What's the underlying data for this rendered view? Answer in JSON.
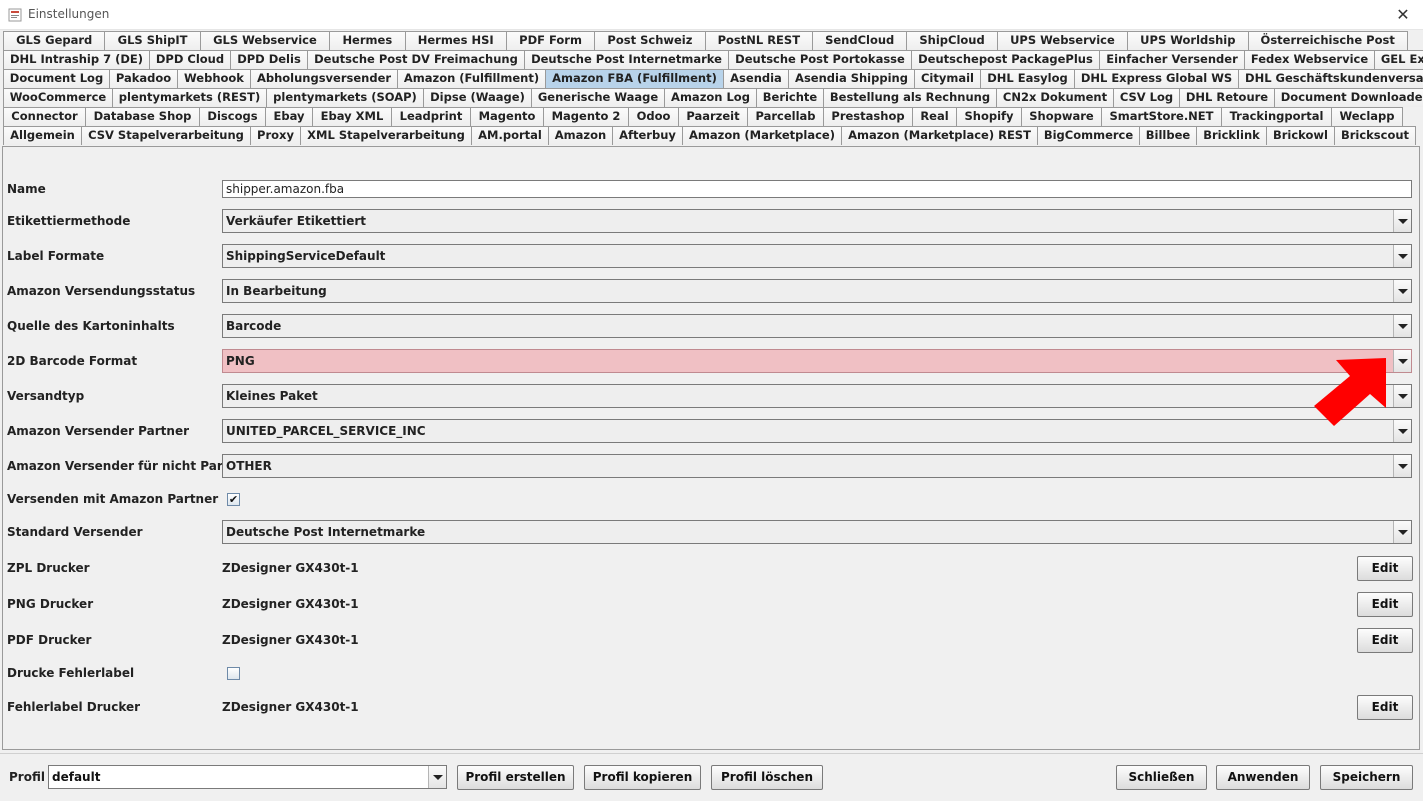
{
  "window": {
    "title": "Einstellungen",
    "close_glyph": "✕"
  },
  "tabs": {
    "rows": [
      [
        "GLS Gepard",
        "GLS ShipIT",
        "GLS Webservice",
        "Hermes",
        "Hermes HSI",
        "PDF Form",
        "Post Schweiz",
        "PostNL REST",
        "SendCloud",
        "ShipCloud",
        "UPS Webservice",
        "UPS Worldship",
        "Österreichische Post"
      ],
      [
        "DHL Intraship 7 (DE)",
        "DPD Cloud",
        "DPD Delis",
        "Deutsche Post DV Freimachung",
        "Deutsche Post Internetmarke",
        "Deutsche Post Portokasse",
        "Deutschepost PackagePlus",
        "Einfacher Versender",
        "Fedex Webservice",
        "GEL Express"
      ],
      [
        "Document Log",
        "Pakadoo",
        "Webhook",
        "Abholungsversender",
        "Amazon (Fulfillment)",
        "Amazon FBA (Fulfillment)",
        "Asendia",
        "Asendia Shipping",
        "Citymail",
        "DHL Easylog",
        "DHL Express Global WS",
        "DHL Geschäftskundenversand"
      ],
      [
        "WooCommerce",
        "plentymarkets (REST)",
        "plentymarkets (SOAP)",
        "Dipse (Waage)",
        "Generische Waage",
        "Amazon Log",
        "Berichte",
        "Bestellung als Rechnung",
        "CN2x Dokument",
        "CSV Log",
        "DHL Retoure",
        "Document Downloader"
      ],
      [
        "Connector",
        "Database Shop",
        "Discogs",
        "Ebay",
        "Ebay XML",
        "Leadprint",
        "Magento",
        "Magento 2",
        "Odoo",
        "Paarzeit",
        "Parcellab",
        "Prestashop",
        "Real",
        "Shopify",
        "Shopware",
        "SmartStore.NET",
        "Trackingportal",
        "Weclapp"
      ],
      [
        "Allgemein",
        "CSV Stapelverarbeitung",
        "Proxy",
        "XML Stapelverarbeitung",
        "AM.portal",
        "Amazon",
        "Afterbuy",
        "Amazon (Marketplace)",
        "Amazon (Marketplace) REST",
        "BigCommerce",
        "Billbee",
        "Bricklink",
        "Brickowl",
        "Brickscout"
      ]
    ],
    "active": "Amazon FBA (Fulfillment)"
  },
  "form": {
    "name": {
      "label": "Name",
      "value": "shipper.amazon.fba"
    },
    "etikettiermethode": {
      "label": "Etikettiermethode",
      "value": "Verkäufer Etikettiert"
    },
    "label_formate": {
      "label": "Label Formate",
      "value": "ShippingServiceDefault"
    },
    "versandungsstatus": {
      "label": "Amazon Versendungsstatus",
      "value": "In Bearbeitung"
    },
    "kartoninhalt": {
      "label": "Quelle des Kartoninhalts",
      "value": "Barcode"
    },
    "barcode_format": {
      "label": "2D Barcode Format",
      "value": "PNG"
    },
    "versandtyp": {
      "label": "Versandtyp",
      "value": "Kleines Paket"
    },
    "versender_partner": {
      "label": "Amazon Versender Partner",
      "value": "UNITED_PARCEL_SERVICE_INC"
    },
    "versender_nicht_partner": {
      "label": "Amazon Versender für nicht Partner",
      "value": "OTHER"
    },
    "mit_partner": {
      "label": "Versenden mit Amazon Partner",
      "checked": "✔"
    },
    "standard_versender": {
      "label": "Standard Versender",
      "value": "Deutsche Post Internetmarke"
    },
    "zpl_drucker": {
      "label": "ZPL Drucker",
      "value": "ZDesigner GX430t-1"
    },
    "png_drucker": {
      "label": "PNG Drucker",
      "value": "ZDesigner GX430t-1"
    },
    "pdf_drucker": {
      "label": "PDF Drucker",
      "value": "ZDesigner GX430t-1"
    },
    "fehlerlabel": {
      "label": "Drucke Fehlerlabel",
      "checked": ""
    },
    "fehlerlabel_drucker": {
      "label": "Fehlerlabel Drucker",
      "value": "ZDesigner GX430t-1"
    },
    "edit_label": "Edit"
  },
  "footer": {
    "profil_label": "Profil",
    "profil_value": "default",
    "erstellen": "Profil erstellen",
    "kopieren": "Profil kopieren",
    "loeschen": "Profil löschen",
    "schliessen": "Schließen",
    "anwenden": "Anwenden",
    "speichern": "Speichern"
  },
  "colors": {
    "active_tab": "#b8d3ea",
    "error_field": "#f0c0c4",
    "annotation_arrow": "#ff0000"
  }
}
